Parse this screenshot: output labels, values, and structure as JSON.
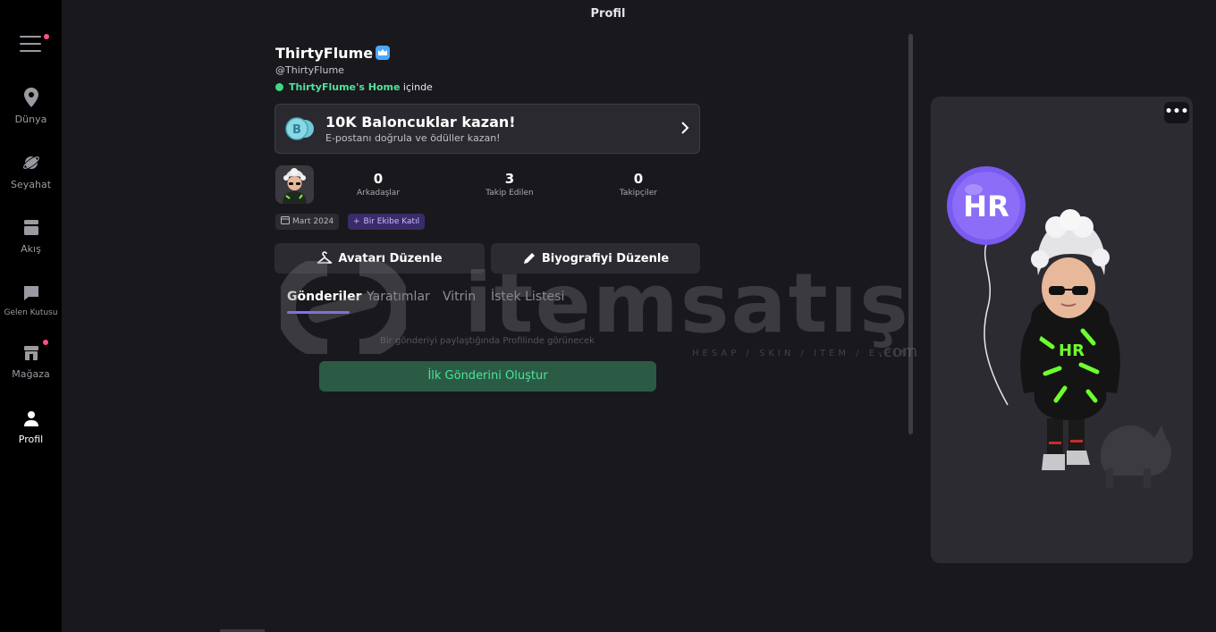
{
  "page": {
    "title": "Profil"
  },
  "sidebar": {
    "items": [
      {
        "label": "Dünya",
        "icon": "location-pin-icon"
      },
      {
        "label": "Seyahat",
        "icon": "planet-icon"
      },
      {
        "label": "Akış",
        "icon": "feed-icon"
      },
      {
        "label": "Gelen Kutusu",
        "icon": "inbox-icon"
      },
      {
        "label": "Mağaza",
        "icon": "shop-icon"
      },
      {
        "label": "Profil",
        "icon": "user-icon"
      }
    ]
  },
  "profile": {
    "username": "ThirtyFlume",
    "handle": "@ThirtyFlume",
    "location_place": "ThirtyFlume's Home",
    "location_suffix": " içinde",
    "joined": "Mart 2024",
    "team_button": "Bir Ekibe Katıl",
    "stats": [
      {
        "value": "0",
        "label": "Arkadaşlar"
      },
      {
        "value": "3",
        "label": "Takip Edilen"
      },
      {
        "value": "0",
        "label": "Takipçiler"
      }
    ]
  },
  "promo": {
    "title": "10K Baloncuklar kazan!",
    "subtitle": "E-postanı doğrula ve ödüller kazan!",
    "coin_letter": "B"
  },
  "actions": {
    "edit_avatar": "Avatarı Düzenle",
    "edit_bio": "Biyografiyi Düzenle"
  },
  "tabs": [
    "Gönderiler",
    "Yaratımlar",
    "Vitrin",
    "İstek Listesi"
  ],
  "posts": {
    "empty_text": "Bir gönderiyi paylaştığında Profilinde görünecek",
    "create_button": "İlk Gönderini Oluştur"
  },
  "avatar_panel": {
    "more_label": "•••",
    "balloon_text": "HR"
  },
  "watermark": {
    "text": "itemsatış",
    "sub": "HESAP / SKIN / ITEM / E-PIN",
    "com": ".com"
  },
  "colors": {
    "accent": "#8a6bff",
    "green": "#4ee39b",
    "notif": "#ff4f8b"
  }
}
